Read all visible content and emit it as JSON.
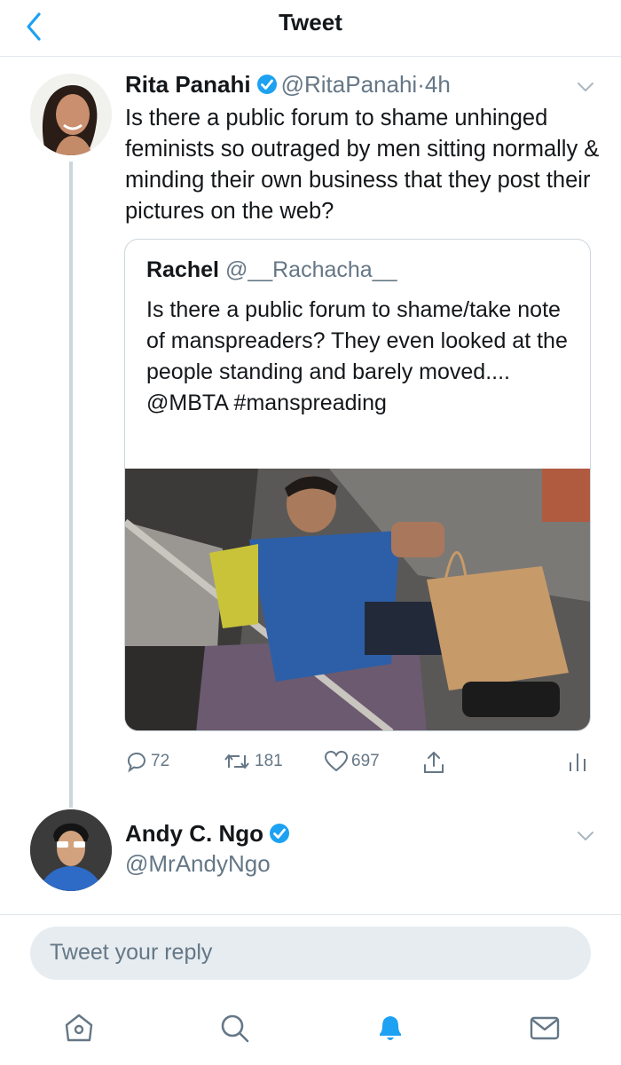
{
  "header": {
    "title": "Tweet"
  },
  "tweet": {
    "name": "Rita Panahi",
    "handle": "@RitaPanahi",
    "separator": "·",
    "time": "4h",
    "text": "Is there a public forum to shame unhinged feminists so outraged by men sitting normally & minding their own business that they post their pictures on the web?",
    "quote": {
      "name": "Rachel",
      "handle": "@__Rachacha__",
      "text": "Is there a public forum to shame/take note of manspreaders? They even looked at the people standing and barely moved.... @MBTA #manspreading"
    },
    "actions": {
      "replies": "72",
      "retweets": "181",
      "likes": "697"
    }
  },
  "reply_author": {
    "name": "Andy C. Ngo",
    "handle": "@MrAndyNgo"
  },
  "reply_box": {
    "placeholder": "Tweet your reply"
  },
  "colors": {
    "accent": "#1da1f2",
    "muted": "#657786",
    "border": "#e1e8ed"
  },
  "icons": {
    "back": "chevron-left-icon",
    "verified": "verified-badge-icon",
    "caret": "chevron-down-icon",
    "reply": "reply-icon",
    "retweet": "retweet-icon",
    "like": "heart-icon",
    "share": "share-icon",
    "analytics": "analytics-icon",
    "tabs": [
      "home-icon",
      "search-icon",
      "notifications-icon",
      "messages-icon"
    ]
  }
}
